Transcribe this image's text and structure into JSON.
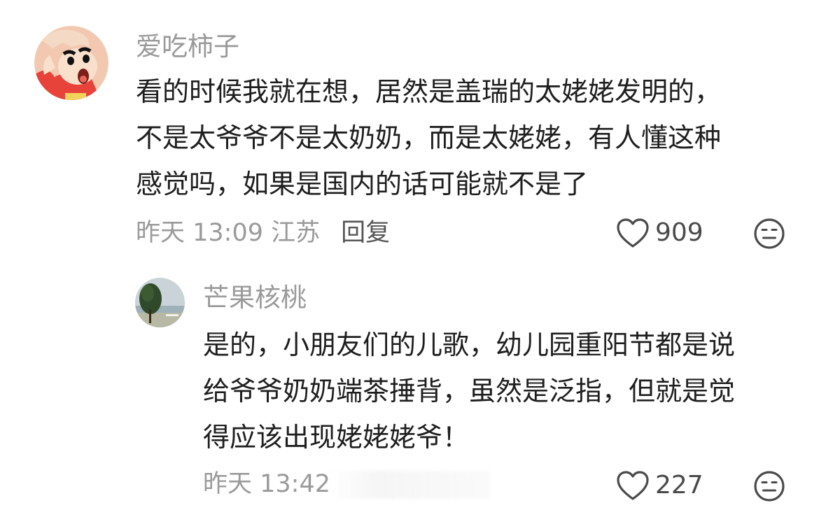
{
  "comments": [
    {
      "username": "爱吃柿子",
      "avatar_icon": "crayon-shinchan-avatar",
      "lines": [
        "看的时候我就在想，居然是盖瑞的太姥姥发明的，",
        "不是太爷爷不是太奶奶，而是太姥姥，有人懂这种",
        "感觉吗，如果是国内的话可能就不是了"
      ],
      "meta": "昨天 13:09 江苏",
      "reply_label": "回复",
      "likes": "909",
      "like_icon": "heart-outline-icon",
      "dislike_icon": "meh-face-icon"
    },
    {
      "username": "芒果核桃",
      "avatar_icon": "tree-seaside-avatar",
      "lines": [
        "是的，小朋友们的儿歌，幼儿园重阳节都是说",
        "给爷爷奶奶端茶捶背，虽然是泛指，但就是觉",
        "得应该出现姥姥姥爷！"
      ],
      "meta": "昨天 13:42",
      "likes": "227",
      "like_icon": "heart-outline-icon",
      "dislike_icon": "meh-face-icon"
    }
  ],
  "colors": {
    "username": "#9a9a9a",
    "text": "#1e1e1e",
    "meta": "#9a9a9a",
    "reply": "#555555",
    "icon": "#4a4a4a"
  }
}
